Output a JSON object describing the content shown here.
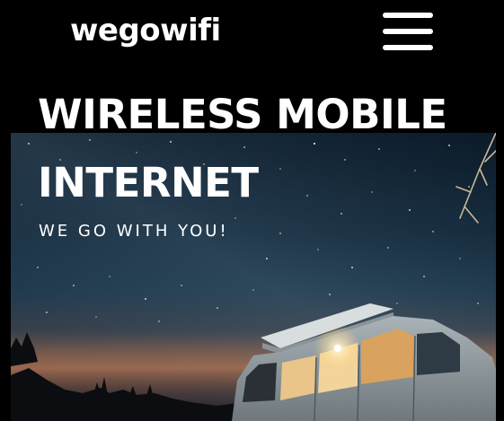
{
  "header": {
    "logo_text": "wegowifi",
    "menu_icon": "hamburger-menu-icon"
  },
  "hero": {
    "title_line_1": "WIRELESS MOBILE",
    "title_line_2": "INTERNET",
    "subtitle": "WE GO WITH YOU!",
    "image": "van-under-starry-night-sky"
  },
  "colors": {
    "background": "#000000",
    "text": "#ffffff"
  }
}
